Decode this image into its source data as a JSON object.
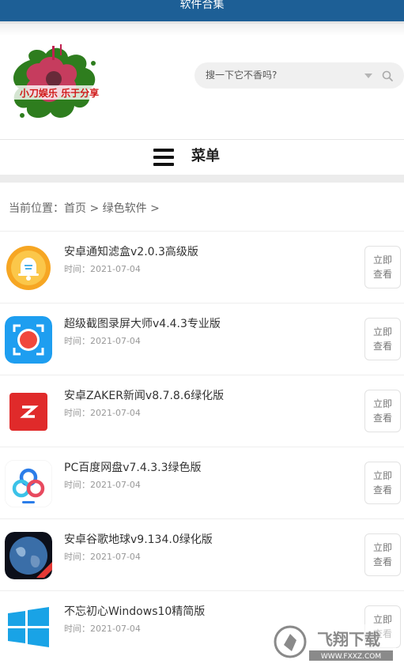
{
  "header": {
    "title": "软件合集"
  },
  "logo": {
    "text": "小刀娱乐 乐于分享"
  },
  "search": {
    "placeholder": "搜一下它不香吗?"
  },
  "menu": {
    "label": "菜单"
  },
  "breadcrumb": {
    "prefix": "当前位置：",
    "home": "首页",
    "sep": " > ",
    "category": "绿色软件",
    "tail": " >"
  },
  "list": {
    "button_line1": "立即",
    "button_line2": "查看",
    "date_prefix": "时间：",
    "items": [
      {
        "name": "安卓通知滤盒v2.0.3高级版",
        "date": "2021-07-04",
        "icon": "bell-app-icon"
      },
      {
        "name": "超级截图录屏大师v4.4.3专业版",
        "date": "2021-07-04",
        "icon": "screen-recorder-icon"
      },
      {
        "name": "安卓ZAKER新闻v8.7.8.6绿化版",
        "date": "2021-07-04",
        "icon": "zaker-icon"
      },
      {
        "name": "PC百度网盘v7.4.3.3绿色版",
        "date": "2021-07-04",
        "icon": "baidu-netdisk-icon"
      },
      {
        "name": "安卓谷歌地球v9.134.0绿化版",
        "date": "2021-07-04",
        "icon": "google-earth-icon"
      },
      {
        "name": "不忘初心Windows10精简版",
        "date": "2021-07-04",
        "icon": "windows-icon"
      }
    ]
  },
  "watermark": {
    "text": "飞翔下载",
    "url": "WWW.FXXZ.COM"
  },
  "colors": {
    "topbar": "#1d5f96",
    "accent_red": "#e03c3c"
  }
}
